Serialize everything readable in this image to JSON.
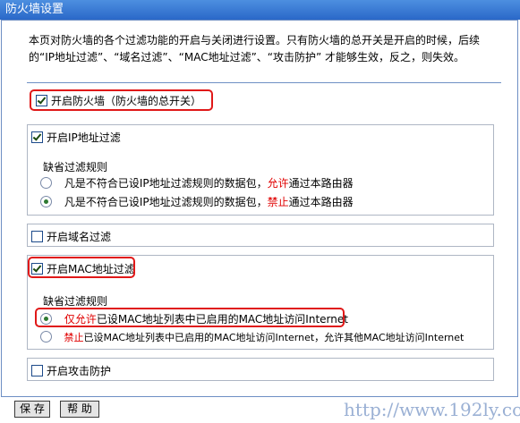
{
  "window": {
    "title": "防火墙设置"
  },
  "description": "本页对防火墙的各个过滤功能的开启与关闭进行设置。只有防火墙的总开关是开启的时候，后续的“IP地址过滤”、“域名过滤”、“MAC地址过滤”、“攻击防护” 才能够生效，反之，则失效。",
  "master_switch": {
    "label": "开启防火墙（防火墙的总开关）",
    "checked": true
  },
  "ip_filter": {
    "label": "开启IP地址过滤",
    "checked": true,
    "default_rule_title": "缺省过滤规则",
    "options": [
      {
        "prefix": "凡是不符合已设IP地址过滤规则的数据包，",
        "keyword": "允许",
        "suffix": "通过本路由器",
        "selected": false
      },
      {
        "prefix": "凡是不符合已设IP地址过滤规则的数据包，",
        "keyword": "禁止",
        "suffix": "通过本路由器",
        "selected": true
      }
    ]
  },
  "domain_filter": {
    "label": "开启域名过滤",
    "checked": false
  },
  "mac_filter": {
    "label": "开启MAC地址过滤",
    "checked": true,
    "default_rule_title": "缺省过滤规则",
    "options": [
      {
        "keyword": "仅允许",
        "suffix": "已设MAC地址列表中已启用的MAC地址访问Internet",
        "selected": true
      },
      {
        "keyword": "禁止",
        "suffix": "已设MAC地址列表中已启用的MAC地址访问Internet，允许其他MAC地址访问Internet",
        "selected": false
      }
    ]
  },
  "attack_protection": {
    "label": "开启攻击防护",
    "checked": false
  },
  "buttons": {
    "save": "保 存",
    "help": "帮 助"
  },
  "watermark": "http://www.192ly.com"
}
